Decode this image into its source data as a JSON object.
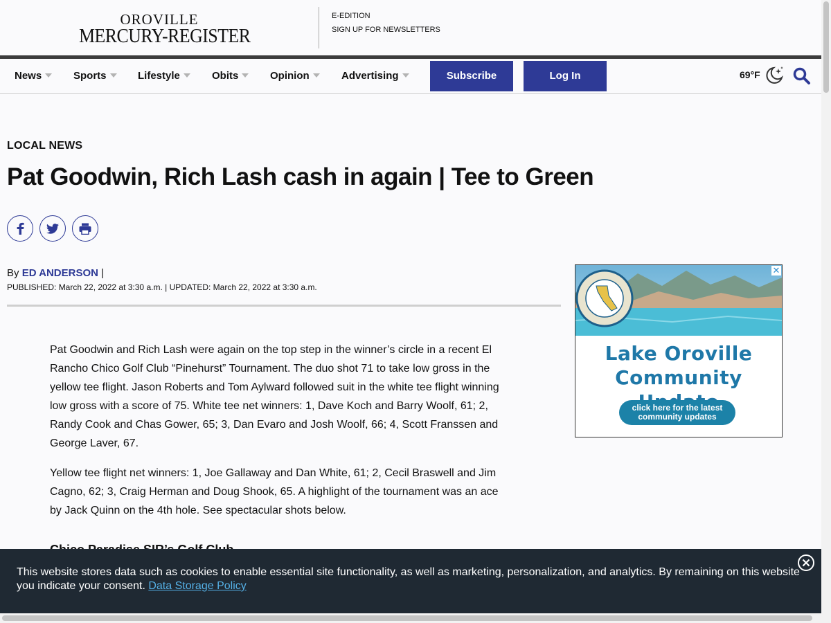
{
  "brand": {
    "line1": "OROVILLE",
    "line2": "MERCURY-REGISTER"
  },
  "top_links": [
    "E-EDITION",
    "SIGN UP FOR NEWSLETTERS"
  ],
  "nav": {
    "items": [
      "News",
      "Sports",
      "Lifestyle",
      "Obits",
      "Opinion",
      "Advertising"
    ],
    "subscribe_label": "Subscribe",
    "login_label": "Log In",
    "weather": "69°F",
    "accent_color": "#2e3a96"
  },
  "article": {
    "kicker": "LOCAL NEWS",
    "headline": "Pat Goodwin, Rich Lash cash in again | Tee to Green",
    "byline_prefix": "By",
    "author": "ED ANDERSON",
    "byline_sep": "|",
    "dates": "PUBLISHED: March 22, 2022 at 3:30 a.m. | UPDATED: March 22, 2022 at 3:30 a.m.",
    "paragraphs": [
      "Pat Goodwin and Rich Lash were again on the top step in the winner’s circle in a recent El Rancho Chico Golf Club “Pinehurst” Tournament. The duo shot 71 to take low gross in the yellow tee flight. Jason Roberts and Tom Aylward followed suit in the white tee flight winning low gross with a score of 75. White tee net winners: 1, Dave Koch and Barry Woolf, 61; 2, Randy Cook and Chas Gower, 65; 3, Dan Evaro and Josh Woolf, 66; 4, Scott Franssen and George Laver, 67.",
      "Yellow tee flight net winners: 1, Joe Gallaway and Dan White, 61; 2, Cecil Braswell and Jim Cagno, 62; 3, Craig Herman and Doug Shook, 65. A highlight of the tournament was an ace by Jack Quinn on the 4th hole. See spectacular shots below."
    ],
    "subhead": "Chico Paradise SIR’s Golf Club"
  },
  "ad": {
    "title_line1": "Lake Oroville",
    "title_line2": "Community Update",
    "cta": "click here for the latest community updates",
    "close": "✕"
  },
  "cookie": {
    "text": "This website stores data such as cookies to enable essential site functionality, as well as marketing, personalization, and analytics. By remaining on this website you indicate your consent.",
    "link": "Data Storage Policy"
  }
}
